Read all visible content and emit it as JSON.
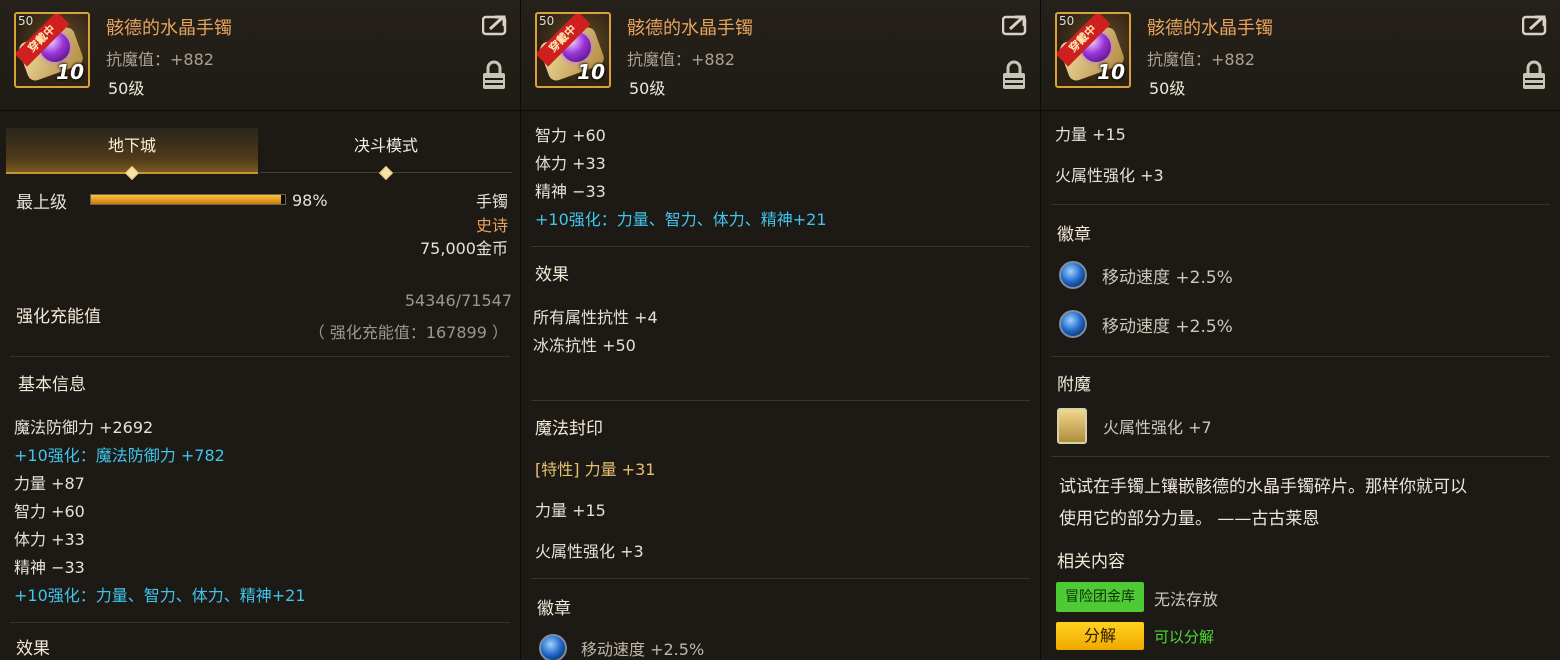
{
  "item": {
    "name": "骸德的水晶手镯",
    "stat": "抗魔值：+882",
    "level": "50级",
    "icon_level": "50",
    "equipped_ribbon": "穿戴中",
    "reinforce": "10"
  },
  "icons": {
    "share": "share-icon",
    "lock": "lock-icon",
    "emblem": "blue-orb-icon",
    "card": "enchant-card-icon"
  },
  "panel1": {
    "tabs": [
      {
        "label": "地下城",
        "active": true
      },
      {
        "label": "决斗模式",
        "active": false
      }
    ],
    "grade_label": "最上级",
    "grade_percent": 0.98,
    "grade_percent_text": "98%",
    "type": "手镯",
    "rarity": "史诗",
    "price": "75,000金币",
    "charge_label": "强化充能值",
    "charge_value": "54346/71547",
    "charge_sub": "（ 强化充能值：167899 ）",
    "basic_title": "基本信息",
    "lines": [
      {
        "text": "魔法防御力 +2692",
        "color": "white"
      },
      {
        "text": "+10强化：魔法防御力 +782",
        "color": "cyan"
      },
      {
        "text": "力量 +87",
        "color": "white"
      },
      {
        "text": "智力 +60",
        "color": "white"
      },
      {
        "text": "体力 +33",
        "color": "white"
      },
      {
        "text": "精神 −33",
        "color": "white"
      },
      {
        "text": "+10强化：力量、智力、体力、精神+21",
        "color": "cyan"
      }
    ],
    "effect_cut": "效果"
  },
  "panel2": {
    "top_lines": [
      "智力 +60",
      "体力 +33",
      "精神 −33"
    ],
    "reinforce_line": "+10强化：力量、智力、体力、精神+21",
    "effect_title": "效果",
    "effect_lines": [
      "所有属性抗性 +4",
      "冰冻抗性 +50"
    ],
    "seal_title": "魔法封印",
    "seal_trait": "[特性] 力量 +31",
    "seal_lines": [
      "力量 +15",
      "火属性强化 +3"
    ],
    "emblem_title": "徽章",
    "emblem_cut": "移动速度 +2.5%"
  },
  "panel3": {
    "top_lines": [
      "力量 +15",
      "火属性强化 +3"
    ],
    "emblem_title": "徽章",
    "emblems": [
      "移动速度 +2.5%",
      "移动速度 +2.5%"
    ],
    "enchant_title": "附魔",
    "enchant": "火属性强化 +7",
    "flavor_1": "试试在手镯上镶嵌骸德的水晶手镯碎片。那样你就可以",
    "flavor_2": "使用它的部分力量。 ——古古莱恩",
    "related_title": "相关内容",
    "related": [
      {
        "badge": "冒险团金库",
        "status": "无法存放"
      },
      {
        "badge": "分解",
        "status": "可以分解"
      }
    ],
    "colors": {
      "green_badge": "#4ecb34",
      "yellow_badge": "#ffd21f",
      "status_ok": "#4ed934"
    }
  }
}
